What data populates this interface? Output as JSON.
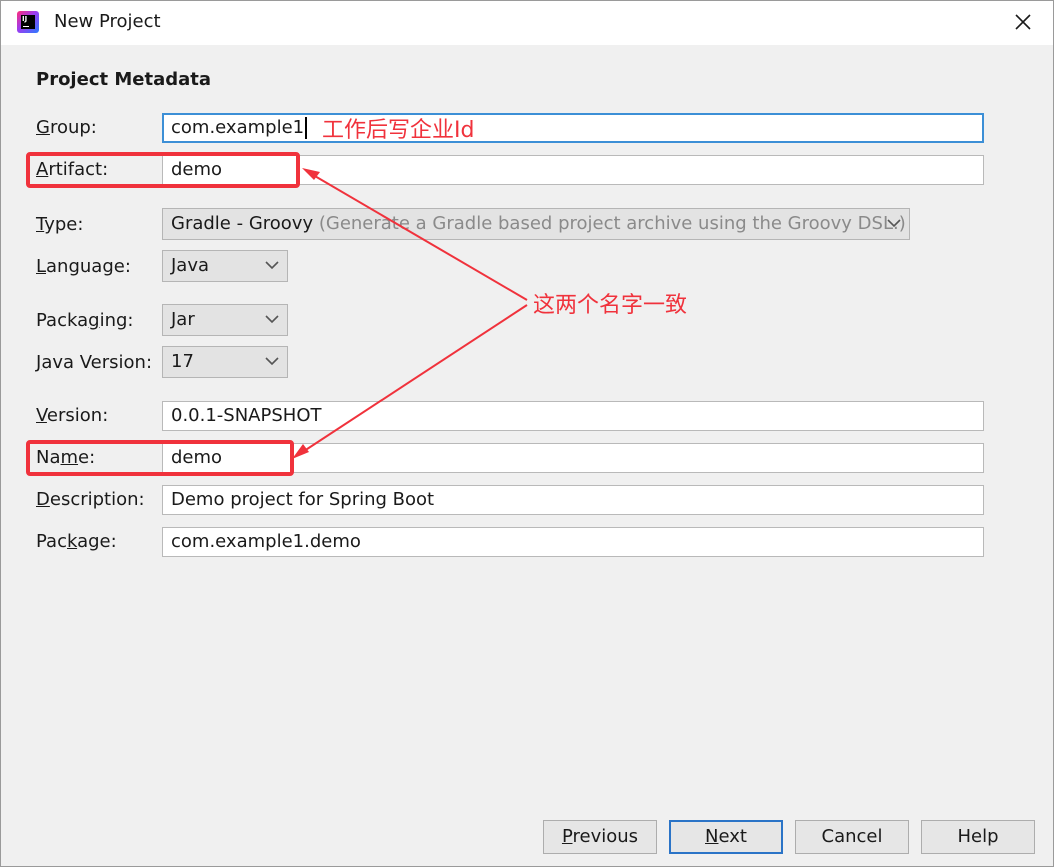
{
  "window": {
    "title": "New Project",
    "app_icon": "intellij-idea-icon"
  },
  "section_title": "Project Metadata",
  "group": {
    "label_u": "G",
    "label_rest": "roup:",
    "value": "com.example1"
  },
  "artifact": {
    "label_u": "A",
    "label_rest": "rtifact:",
    "value": "demo"
  },
  "type": {
    "label_u": "T",
    "label_rest": "ype:",
    "value": "Gradle - Groovy",
    "hint": "(Generate a Gradle based project archive using the Groovy DSL.)"
  },
  "language": {
    "label_u": "L",
    "label_rest": "anguage:",
    "value": "Java"
  },
  "packaging": {
    "label_pre": "Packa",
    "label_u": "g",
    "label_rest": "ing:",
    "value": "Jar"
  },
  "java_version": {
    "label_u": "J",
    "label_rest": "ava Version:",
    "value": "17"
  },
  "version": {
    "label_u": "V",
    "label_rest": "ersion:",
    "value": "0.0.1-SNAPSHOT"
  },
  "name": {
    "label_pre": "Na",
    "label_u": "m",
    "label_rest": "e:",
    "value": "demo"
  },
  "description": {
    "label_u": "D",
    "label_rest": "escription:",
    "value": "Demo project for Spring Boot"
  },
  "package": {
    "label_pre": "Pac",
    "label_u": "k",
    "label_rest": "age:",
    "value": "com.example1.demo"
  },
  "buttons": {
    "previous_u": "P",
    "previous_rest": "revious",
    "next_u": "N",
    "next_rest": "ext",
    "cancel": "Cancel",
    "help": "Help"
  },
  "annotations": {
    "group_note": "工作后写企业Id",
    "names_match": "这两个名字一致",
    "color": "#f0323c"
  }
}
